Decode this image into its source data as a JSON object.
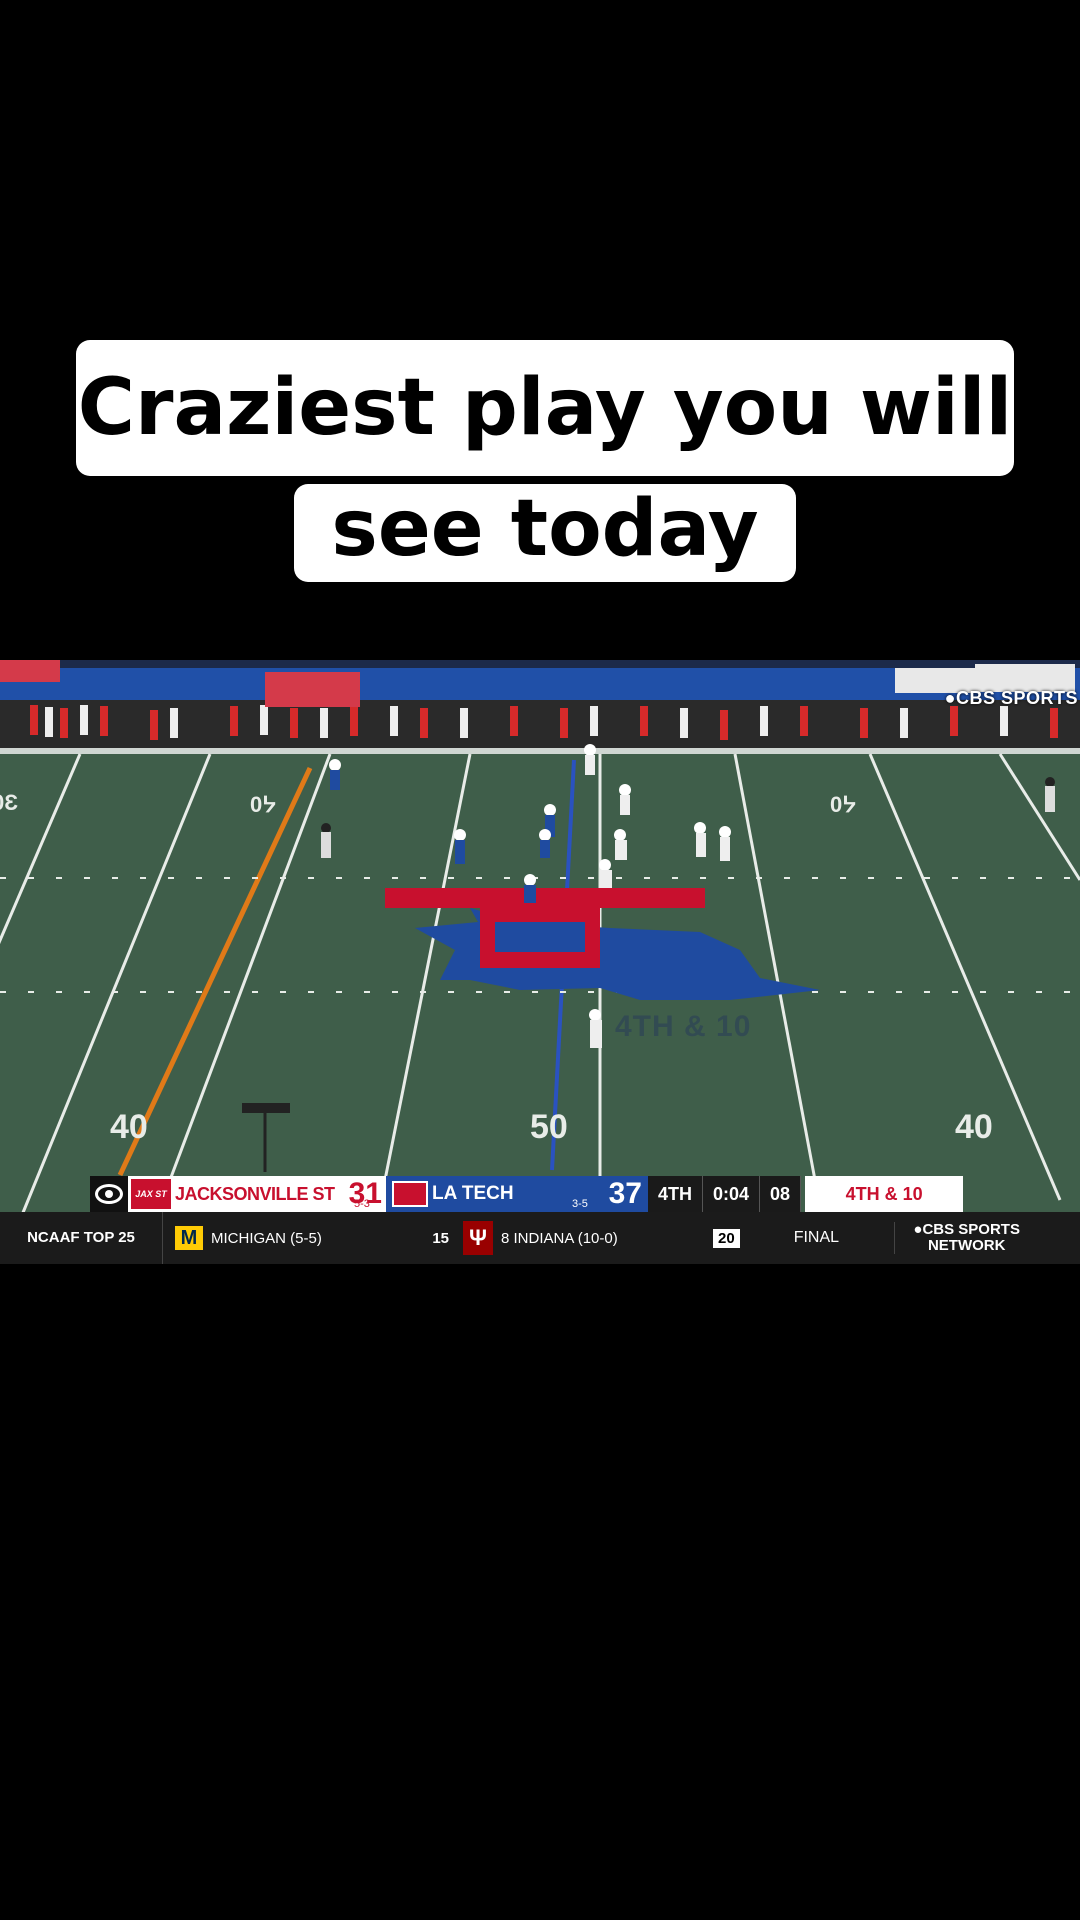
{
  "caption": {
    "line1": "Craziest play you will",
    "line2": "see today"
  },
  "broadcast": {
    "network_bug": "●CBS SPORTS",
    "field_marker": "4TH & 10"
  },
  "scorebug": {
    "away": {
      "name": "JACKSONVILLE ST",
      "record": "5-3",
      "score": "31",
      "color": "#c8102e"
    },
    "home": {
      "name": "LA TECH",
      "record": "3-5",
      "score": "37",
      "color": "#1f4ba0"
    },
    "quarter": "4TH",
    "clock": "0:04",
    "play_clock": "08",
    "down_distance": "4TH & 10"
  },
  "ticker": {
    "label": "NCAAF TOP 25",
    "team1": {
      "name": "MICHIGAN",
      "record": "(5-5)",
      "score": "15"
    },
    "team2": {
      "name": "8 INDIANA",
      "record": "(10-0)",
      "score": "20"
    },
    "status": "FINAL",
    "network": "●CBS SPORTS NETWORK"
  }
}
